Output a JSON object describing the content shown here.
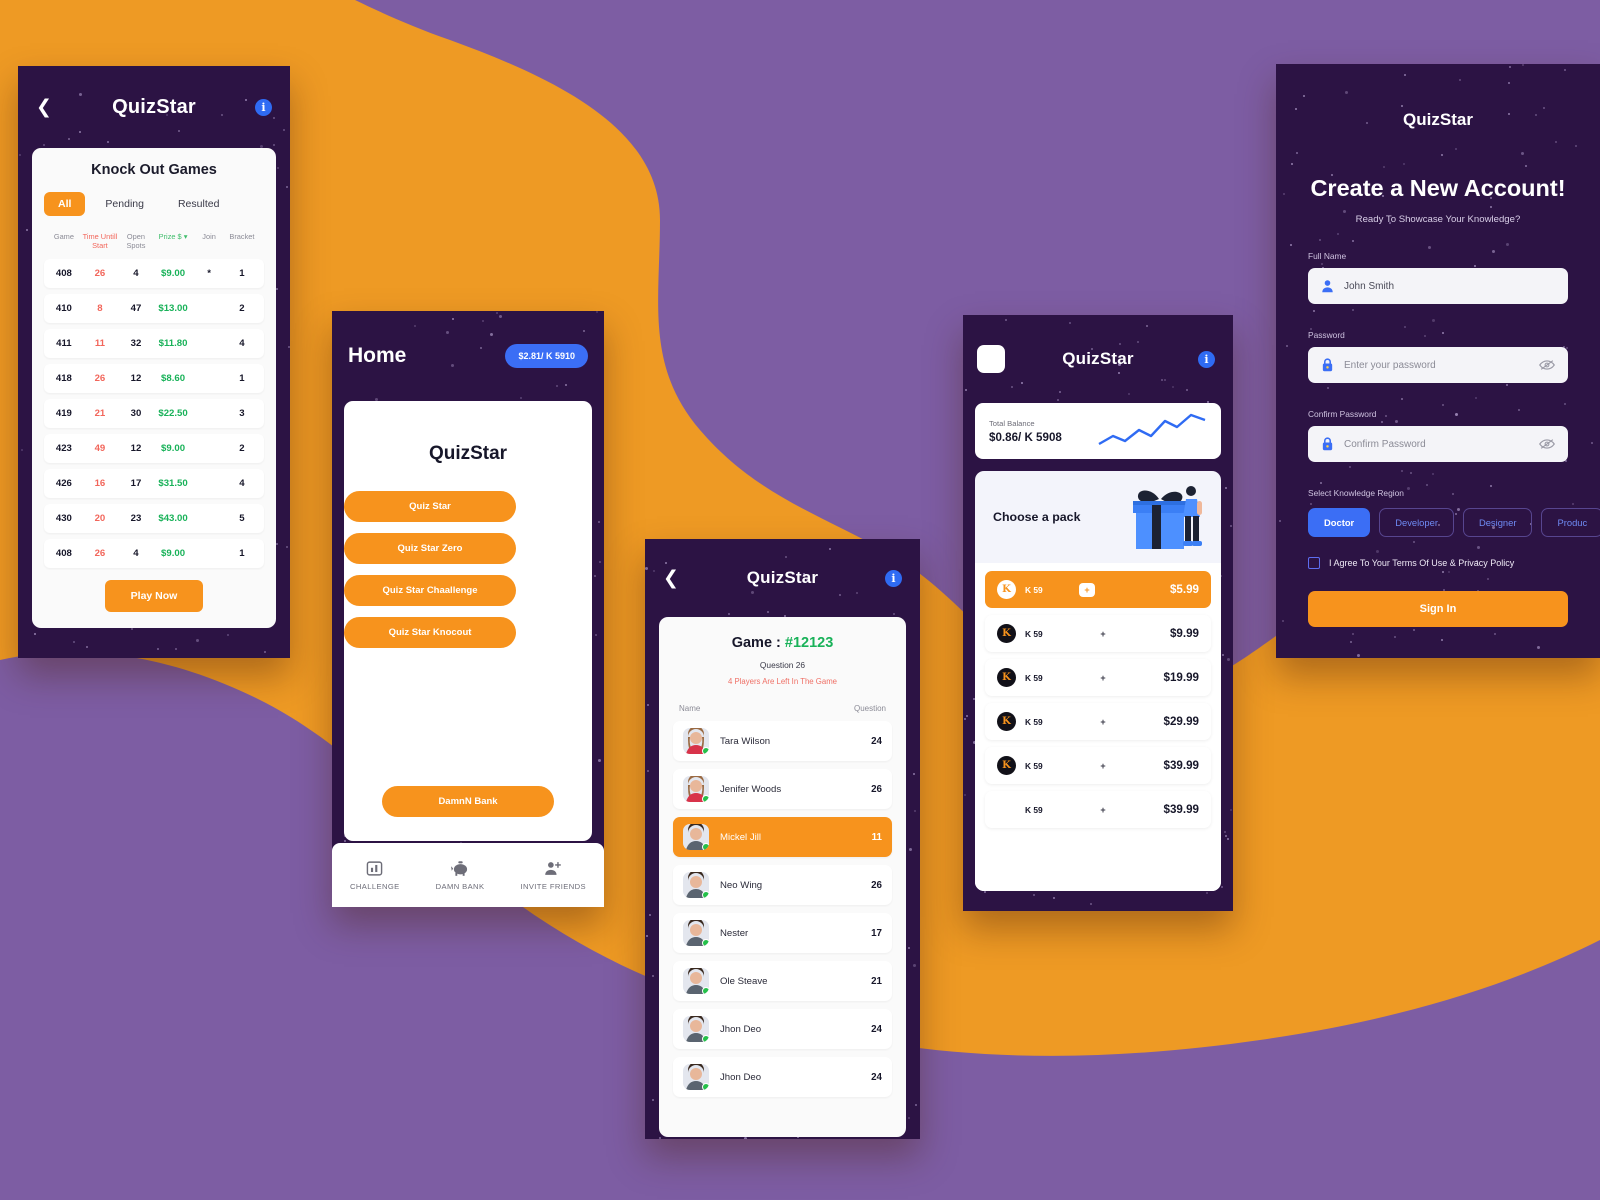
{
  "theme": {
    "orange": "#ee9a24",
    "purple": "#7d5da3",
    "phone_bg": "#2c1344",
    "accent_orange": "#f7931d",
    "accent_blue": "#3b6ef5",
    "green": "#19b259",
    "red": "#f2665b"
  },
  "knockout": {
    "nav": {
      "back_icon": "chevron-left-icon",
      "title": "QuizStar",
      "info_icon": "info-icon",
      "info_glyph": "i"
    },
    "card_title": "Knock Out Games",
    "tabs": [
      {
        "label": "All",
        "active": true
      },
      {
        "label": "Pending",
        "active": false
      },
      {
        "label": "Resulted",
        "active": false
      }
    ],
    "columns": [
      "Game",
      "Time Untill Start",
      "Open Spots",
      "Prize $",
      "Join",
      "Bracket"
    ],
    "sort_icon": "chevron-down-icon",
    "rows": [
      {
        "game": "408",
        "time": "26",
        "spots": "4",
        "prize": "$9.00",
        "join": "*",
        "bracket": "1"
      },
      {
        "game": "410",
        "time": "8",
        "spots": "47",
        "prize": "$13.00",
        "join": "",
        "bracket": "2"
      },
      {
        "game": "411",
        "time": "11",
        "spots": "32",
        "prize": "$11.80",
        "join": "",
        "bracket": "4"
      },
      {
        "game": "418",
        "time": "26",
        "spots": "12",
        "prize": "$8.60",
        "join": "",
        "bracket": "1"
      },
      {
        "game": "419",
        "time": "21",
        "spots": "30",
        "prize": "$22.50",
        "join": "",
        "bracket": "3"
      },
      {
        "game": "423",
        "time": "49",
        "spots": "12",
        "prize": "$9.00",
        "join": "",
        "bracket": "2"
      },
      {
        "game": "426",
        "time": "16",
        "spots": "17",
        "prize": "$31.50",
        "join": "",
        "bracket": "4"
      },
      {
        "game": "430",
        "time": "20",
        "spots": "23",
        "prize": "$43.00",
        "join": "",
        "bracket": "5"
      },
      {
        "game": "408",
        "time": "26",
        "spots": "4",
        "prize": "$9.00",
        "join": "",
        "bracket": "1"
      }
    ],
    "play_now": "Play Now"
  },
  "home": {
    "title": "Home",
    "balance": "$2.81/ K 5910",
    "logo": "QuizStar",
    "buttons": [
      "Quiz Star",
      "Quiz Star Zero",
      "Quiz Star Chaallenge",
      "Quiz Star Knocout"
    ],
    "bank_button": "DamnN Bank",
    "tabbar": [
      {
        "label": "CHALLENGE",
        "icon": "bar-chart-icon"
      },
      {
        "label": "DAMN BANK",
        "icon": "piggy-bank-icon"
      },
      {
        "label": "INVITE FRIENDS",
        "icon": "add-person-icon"
      }
    ]
  },
  "game": {
    "nav": {
      "back_icon": "chevron-left-icon",
      "title": "QuizStar",
      "info_glyph": "i"
    },
    "title_label": "Game : ",
    "game_id": "#12123",
    "question_line": "Question 26",
    "players_left": "4 Players Are Left In The Game",
    "columns": {
      "name": "Name",
      "question": "Question"
    },
    "players": [
      {
        "name": "Tara Wilson",
        "score": "24",
        "active": false,
        "gender": "f"
      },
      {
        "name": "Jenifer Woods",
        "score": "26",
        "active": false,
        "gender": "f"
      },
      {
        "name": "Mickel Jill",
        "score": "11",
        "active": true,
        "gender": "m"
      },
      {
        "name": "Neo Wing",
        "score": "26",
        "active": false,
        "gender": "m"
      },
      {
        "name": "Nester",
        "score": "17",
        "active": false,
        "gender": "m"
      },
      {
        "name": "Ole Steave",
        "score": "21",
        "active": false,
        "gender": "m"
      },
      {
        "name": "Jhon Deo",
        "score": "24",
        "active": false,
        "gender": "m"
      },
      {
        "name": "Jhon Deo",
        "score": "24",
        "active": false,
        "gender": "m"
      }
    ]
  },
  "pack": {
    "nav": {
      "menu_icon": "menu-square-icon",
      "title": "QuizStar",
      "info_glyph": "i"
    },
    "balance_label": "Total Balance",
    "balance_value": "$0.86/ K 5908",
    "sparkline_icon": "line-chart-icon",
    "hero_title": "Choose a pack",
    "hero_icon": "gift-illustration",
    "coin_glyph": "K",
    "rows": [
      {
        "coins": "K 59",
        "plus": "+",
        "price": "$5.99",
        "active": true,
        "coin": true
      },
      {
        "coins": "K 59",
        "plus": "+",
        "price": "$9.99",
        "active": false,
        "coin": true
      },
      {
        "coins": "K 59",
        "plus": "+",
        "price": "$19.99",
        "active": false,
        "coin": true
      },
      {
        "coins": "K 59",
        "plus": "+",
        "price": "$29.99",
        "active": false,
        "coin": true
      },
      {
        "coins": "K 59",
        "plus": "+",
        "price": "$39.99",
        "active": false,
        "coin": true
      },
      {
        "coins": "K 59",
        "plus": "+",
        "price": "$39.99",
        "active": false,
        "coin": false
      }
    ]
  },
  "account": {
    "logo": "QuizStar",
    "heading": "Create a New Account!",
    "subheading": "Ready To Showcase Your Knowledge?",
    "fields": [
      {
        "label": "Full Name",
        "value": "John Smith",
        "icon": "person-icon",
        "placeholder": false,
        "eye": false
      },
      {
        "label": "Password",
        "value": "Enter your password",
        "icon": "lock-icon",
        "placeholder": true,
        "eye": true
      },
      {
        "label": "Confirm Password",
        "value": "Confirm Password",
        "icon": "lock-icon",
        "placeholder": true,
        "eye": true
      }
    ],
    "region_label": "Select Knowledge Region",
    "regions": [
      {
        "label": "Doctor",
        "active": true
      },
      {
        "label": "Developer",
        "active": false
      },
      {
        "label": "Designer",
        "active": false
      },
      {
        "label": "Produc",
        "active": false
      }
    ],
    "terms": "I Agree To Your Terms Of Use & Privacy Policy",
    "submit": "Sign In"
  }
}
